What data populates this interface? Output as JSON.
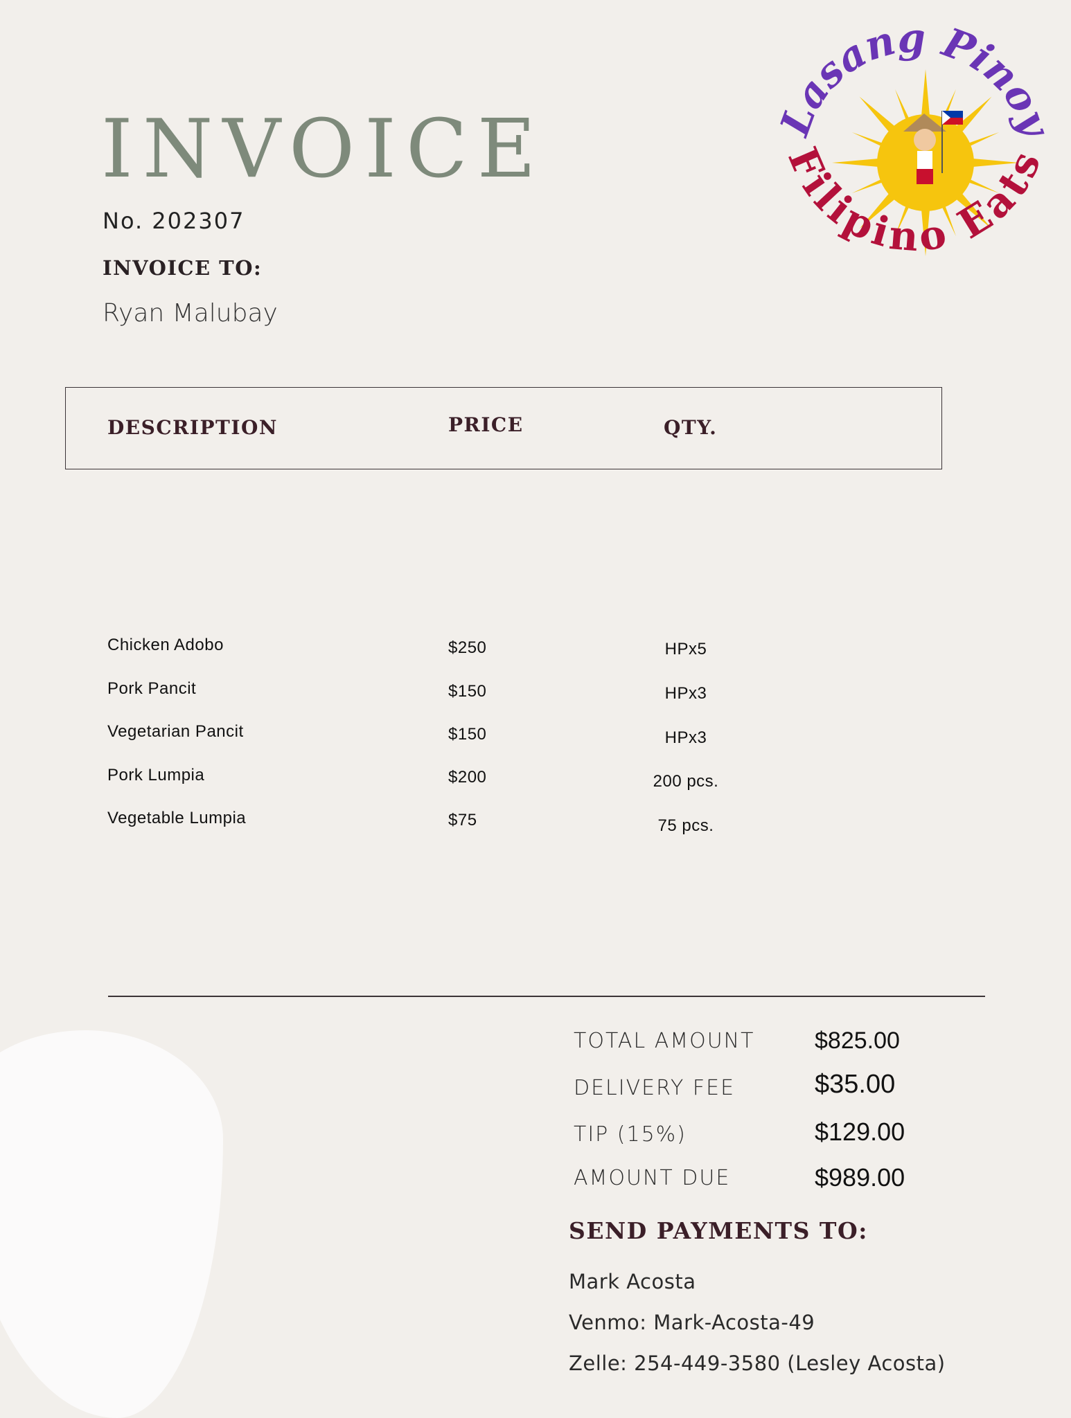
{
  "logo": {
    "top_text": "Lasang Pinoy",
    "bottom_text": "Filipino Eats",
    "icon": "sun-mascot-icon",
    "colors": {
      "top": "#6a35b5",
      "bottom": "#b3113b",
      "sun": "#f6c50e"
    }
  },
  "invoice": {
    "title": "INVOICE",
    "number": "No. 202307",
    "to_label": "INVOICE TO:",
    "to_name": "Ryan Malubay"
  },
  "table": {
    "headers": {
      "description": "DESCRIPTION",
      "price": "PRICE",
      "qty": "QTY."
    },
    "rows": [
      {
        "description": "Chicken Adobo",
        "price": "$250",
        "qty": "HPx5"
      },
      {
        "description": "Pork Pancit",
        "price": "$150",
        "qty": "HPx3"
      },
      {
        "description": "Vegetarian Pancit",
        "price": "$150",
        "qty": "HPx3"
      },
      {
        "description": "Pork Lumpia",
        "price": "$200",
        "qty": "200 pcs."
      },
      {
        "description": "Vegetable Lumpia",
        "price": "$75",
        "qty": "75 pcs."
      }
    ]
  },
  "summary": [
    {
      "label": "TOTAL AMOUNT",
      "value": "$825.00"
    },
    {
      "label": "DELIVERY FEE",
      "value": "$35.00"
    },
    {
      "label": "TIP (15%)",
      "value": "$129.00"
    },
    {
      "label": "AMOUNT DUE",
      "value": "$989.00"
    }
  ],
  "payment": {
    "title": "SEND PAYMENTS TO:",
    "lines": [
      "Mark Acosta",
      "Venmo: Mark-Acosta-49",
      "Zelle: 254-449-3580 (Lesley Acosta)"
    ]
  }
}
